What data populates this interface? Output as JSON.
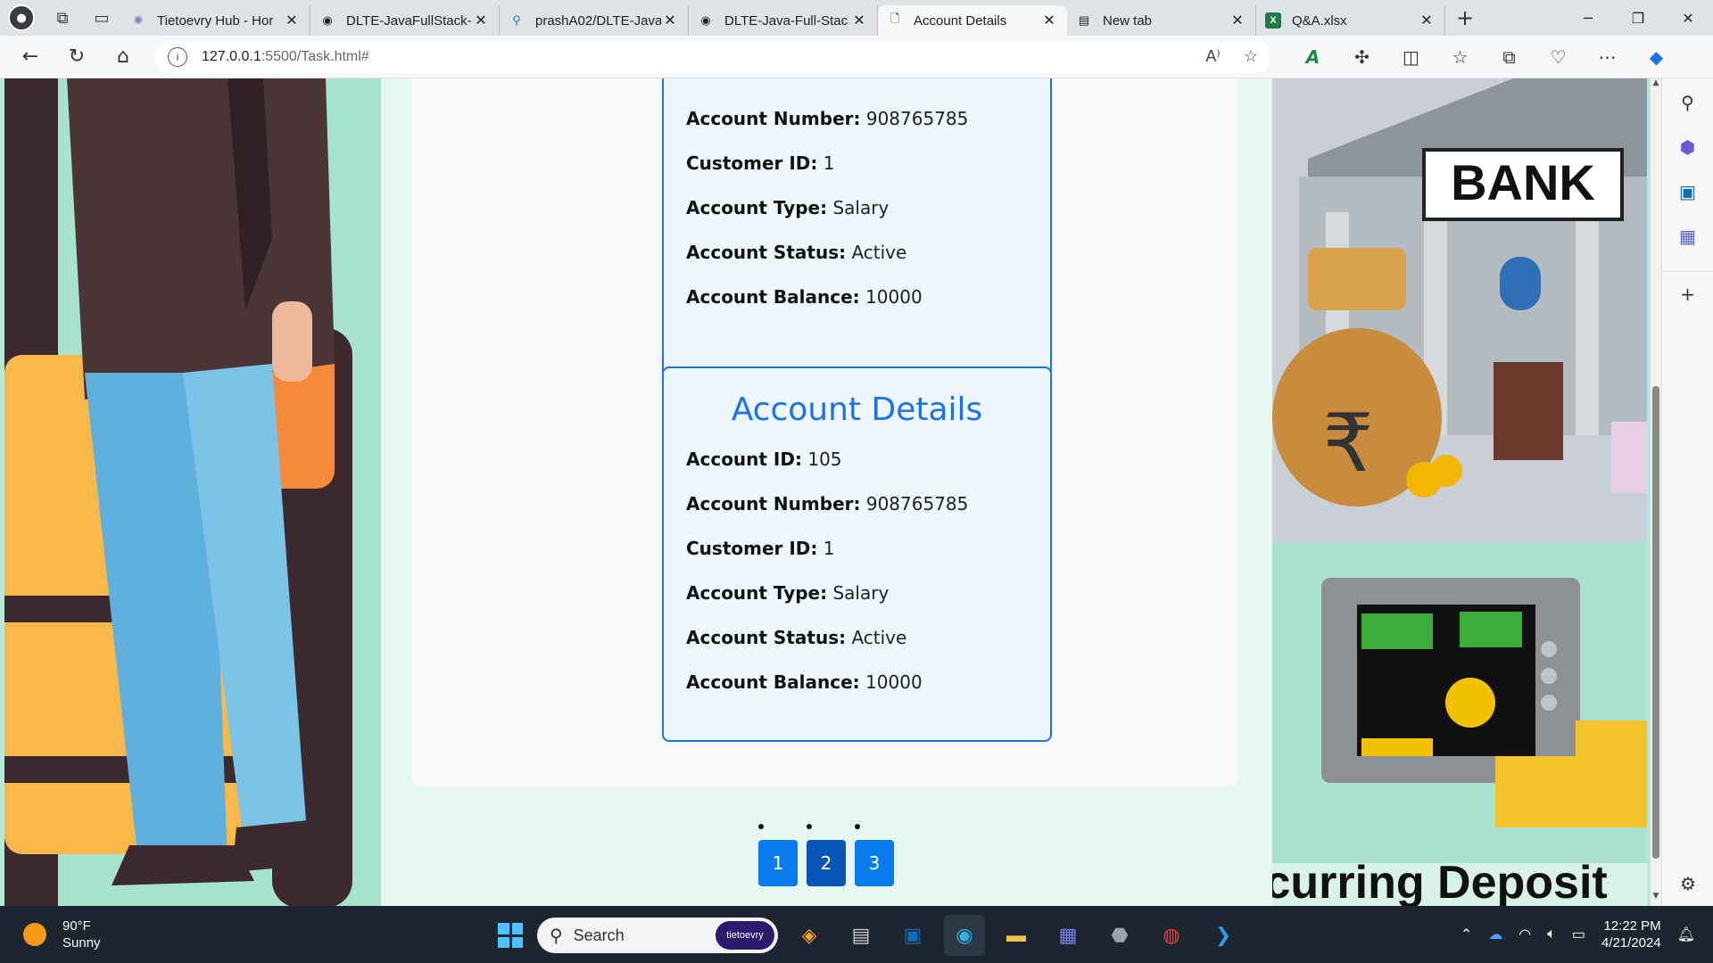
{
  "browser": {
    "tabs": [
      {
        "title": "Tietoevry Hub - Hor",
        "icon": "tietoevry-icon"
      },
      {
        "title": "DLTE-JavaFullStack-",
        "icon": "github-icon"
      },
      {
        "title": "prashA02/DLTE-Java",
        "icon": "search-icon"
      },
      {
        "title": "DLTE-Java-Full-Stac",
        "icon": "github-icon"
      },
      {
        "title": "Account Details",
        "icon": "page-icon",
        "active": true
      },
      {
        "title": "New tab",
        "icon": "newtab-icon"
      },
      {
        "title": "Q&A.xlsx",
        "icon": "excel-icon"
      }
    ],
    "address": {
      "host": "127.0.0.1",
      "rest": ":5500/Task.html#"
    }
  },
  "page": {
    "cards": [
      {
        "rows": [
          {
            "label": "Account Number:",
            "value": "908765785"
          },
          {
            "label": "Customer ID:",
            "value": "1"
          },
          {
            "label": "Account Type:",
            "value": "Salary"
          },
          {
            "label": "Account Status:",
            "value": "Active"
          },
          {
            "label": "Account Balance:",
            "value": "10000"
          }
        ]
      },
      {
        "title": "Account Details",
        "rows": [
          {
            "label": "Account ID:",
            "value": "105"
          },
          {
            "label": "Account Number:",
            "value": "908765785"
          },
          {
            "label": "Customer ID:",
            "value": "1"
          },
          {
            "label": "Account Type:",
            "value": "Salary"
          },
          {
            "label": "Account Status:",
            "value": "Active"
          },
          {
            "label": "Account Balance:",
            "value": "10000"
          }
        ]
      }
    ],
    "pagination": [
      "1",
      "2",
      "3"
    ],
    "current_page": "2",
    "right_image": {
      "sign": "BANK",
      "caption": "Recurring Deposit"
    }
  },
  "taskbar": {
    "weather": {
      "temp": "90°F",
      "condition": "Sunny"
    },
    "search_placeholder": "Search",
    "search_badge": "tietoevry",
    "time": "12:22 PM",
    "date": "4/21/2024"
  },
  "colors": {
    "accent": "#1a73e8",
    "button": "#0a7cf0",
    "taskbar": "#1c2530"
  }
}
